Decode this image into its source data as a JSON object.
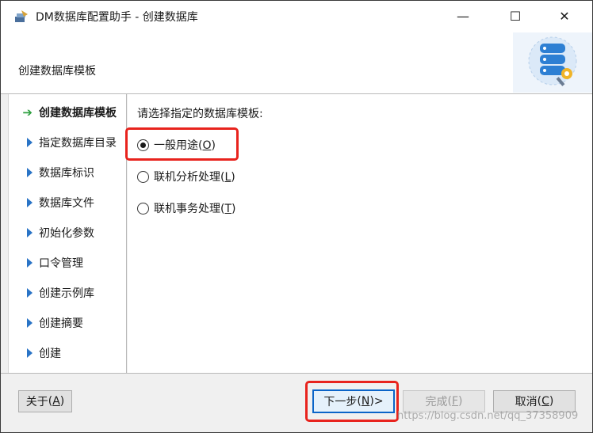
{
  "window": {
    "title": "DM数据库配置助手 - 创建数据库",
    "minimize_glyph": "—",
    "maximize_glyph": "☐",
    "close_glyph": "✕"
  },
  "header": {
    "title": "创建数据库模板",
    "graphic_icon": "database-gear-icon"
  },
  "sidebar": {
    "items": [
      {
        "label": "创建数据库模板",
        "active": true
      },
      {
        "label": "指定数据库目录",
        "active": false
      },
      {
        "label": "数据库标识",
        "active": false
      },
      {
        "label": "数据库文件",
        "active": false
      },
      {
        "label": "初始化参数",
        "active": false
      },
      {
        "label": "口令管理",
        "active": false
      },
      {
        "label": "创建示例库",
        "active": false
      },
      {
        "label": "创建摘要",
        "active": false
      },
      {
        "label": "创建",
        "active": false
      }
    ]
  },
  "main": {
    "prompt": "请选择指定的数据库模板:",
    "options": [
      {
        "label": "一般用途",
        "hotkey": "O",
        "checked": true
      },
      {
        "label": "联机分析处理",
        "hotkey": "L",
        "checked": false
      },
      {
        "label": "联机事务处理",
        "hotkey": "T",
        "checked": false
      }
    ]
  },
  "footer": {
    "about": {
      "label": "关于",
      "hotkey": "A"
    },
    "next": {
      "label": "下一步",
      "hotkey": "N",
      "suffix": " >"
    },
    "finish": {
      "label": "完成",
      "hotkey": "F",
      "enabled": false
    },
    "cancel": {
      "label": "取消",
      "hotkey": "C"
    }
  },
  "watermark": "https://blog.csdn.net/qq_37358909",
  "colors": {
    "highlight_box": "#e8231d",
    "nav_triangle": "#2a74c6",
    "active_arrow": "#2ea040",
    "primary_button_border": "#0a64c8"
  }
}
